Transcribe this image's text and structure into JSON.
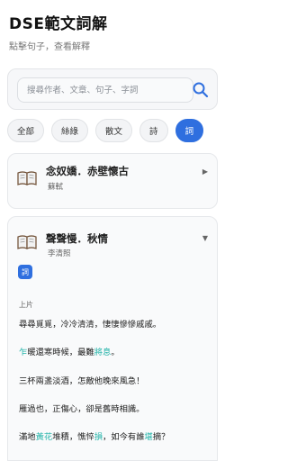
{
  "header": {
    "title": "DSE範文詞解",
    "subtitle": "點擊句子，查看解釋"
  },
  "search": {
    "placeholder": "搜尋作者、文章、句子、字詞",
    "icon": "search-icon"
  },
  "filters": [
    {
      "label": "全部",
      "active": false
    },
    {
      "label": "絲綠",
      "active": false
    },
    {
      "label": "散文",
      "active": false
    },
    {
      "label": "詩",
      "active": false
    },
    {
      "label": "詞",
      "active": true
    }
  ],
  "colors": {
    "accent": "#2f6fdf",
    "highlight": "#22b3a8"
  },
  "poems": [
    {
      "title": "念奴嬌．赤壁懷古",
      "author": "蘇軾",
      "expanded": false,
      "arrow": "▶"
    },
    {
      "title": "聲聲慢．秋情",
      "author": "李清照",
      "expanded": true,
      "arrow": "▼",
      "genre_tag": "詞",
      "section": "上片",
      "lines": [
        "尋尋覓覓，冷冷清清，悽悽慘慘戚戚。",
        "乍暖還寒時候，最難將息。",
        "三杯兩盞淡酒，怎敵他晚來風急！",
        "雁過也，正傷心，卻是舊時相識。",
        "滿地黃花堆積，憔悴損，如今有誰堪摘？"
      ]
    }
  ]
}
